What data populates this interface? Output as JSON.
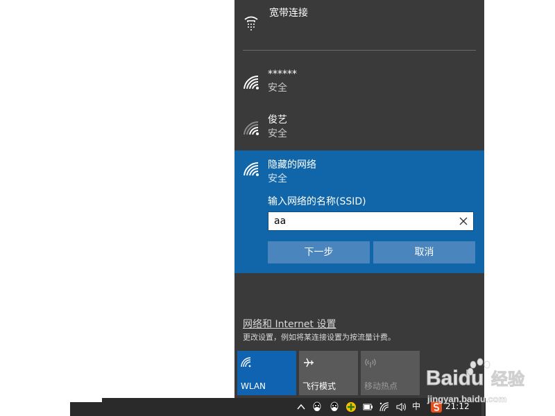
{
  "flyout": {
    "broadband": {
      "label": "宽带连接",
      "icon": "broadband-connection-icon"
    },
    "networks": [
      {
        "name": "******",
        "status": "安全",
        "icon": "wifi-full-icon"
      },
      {
        "name": "俊艺",
        "status": "安全",
        "icon": "wifi-medium-icon"
      }
    ],
    "hidden_network": {
      "name": "隐藏的网络",
      "status": "安全",
      "icon": "wifi-full-icon",
      "ssid_label": "输入网络的名称(SSID)",
      "ssid_value": "aa",
      "clear_icon": "close-icon",
      "next_label": "下一步",
      "cancel_label": "取消"
    },
    "settings": {
      "link_label": "网络和 Internet 设置",
      "description": "更改设置，例如将某连接设置为按流量计费。"
    },
    "quick_actions": [
      {
        "label": "WLAN",
        "icon": "wifi-icon",
        "state": "on"
      },
      {
        "label": "飞行模式",
        "icon": "airplane-icon",
        "state": "off"
      },
      {
        "label": "移动热点",
        "icon": "hotspot-icon",
        "state": "disabled"
      }
    ]
  },
  "taskbar": {
    "ime_label": "中",
    "clock": "21:12",
    "tray_icons": [
      "chevron-up-icon",
      "qq-icon",
      "qq-icon",
      "360-security-icon",
      "battery-icon",
      "network-icon",
      "volume-icon",
      "sogou-input-icon"
    ]
  },
  "watermark": {
    "brand": "Baidu",
    "cn": "经验",
    "url": "jingyan.baidu.com"
  },
  "colors": {
    "panel_bg": "#3a3a3a",
    "accent": "#1066a8",
    "button_bg": "#4a86bd",
    "wlan_tile": "#0f63b0",
    "taskbar_bg": "#2a2a2a"
  }
}
